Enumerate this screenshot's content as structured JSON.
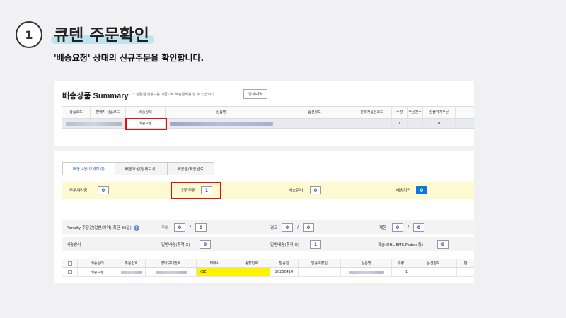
{
  "step": "1",
  "title": "큐텐 주문확인",
  "subtitle": "'배송요청' 상태의 신규주문을 확인합니다.",
  "summary": {
    "title": "배송상품 Summary",
    "note": "* 상품/옵션정보를 기준으로 배송준비를 할 수 있습니다.",
    "detail_button": "상세내역",
    "headers": [
      "상품코드",
      "판매자 상품코드",
      "배송상태",
      "상품명",
      "옵션정보",
      "판매자옵션코드",
      "수량",
      "주문건수",
      "선물하기주문"
    ],
    "row": {
      "status": "배송요청",
      "qty": "1",
      "orders": "1",
      "gift": "N"
    }
  },
  "tabs": [
    "배송요청(요약보기)",
    "배송요청(상세보기)",
    "배송중/배송완료"
  ],
  "counts": {
    "processing_label": "주문처리중",
    "processing": "0",
    "new_label": "신규주문",
    "new": "1",
    "ready_label": "배송준비",
    "ready": "0",
    "delay_label": "배송지연",
    "delay": "0"
  },
  "penalty": {
    "label": "Penalty 주문건(일반/예약)(최근 30일)",
    "notice_label": "주의",
    "notice_a": "0",
    "notice_b": "0",
    "warn_label": "경고",
    "warn_a": "0",
    "warn_b": "0",
    "limit_label": "제한",
    "limit_a": "0",
    "limit_b": "0"
  },
  "shipping": {
    "label": "배송방식",
    "normal_x_label": "일반배송(추적-X)",
    "normal_x": "0",
    "normal_o_label": "일반배송(추적-O)",
    "normal_o": "1",
    "special_label": "특송(DHL,EMS,Fedex 등)",
    "special": "0"
  },
  "orders": {
    "headers": [
      "배송상태",
      "주문번호",
      "장바구니번호",
      "택배사",
      "송장번호",
      "발송일",
      "발송예정일",
      "상품명",
      "수량",
      "옵션정보",
      "판"
    ],
    "row": {
      "status": "배송요청",
      "courier": "KSE",
      "ship_date": "20250414",
      "qty": "1"
    }
  },
  "colors": {
    "highlight_red": "#e01010",
    "accent_blue": "#0a77e8",
    "yellow_bg": "#fdf9d0"
  }
}
